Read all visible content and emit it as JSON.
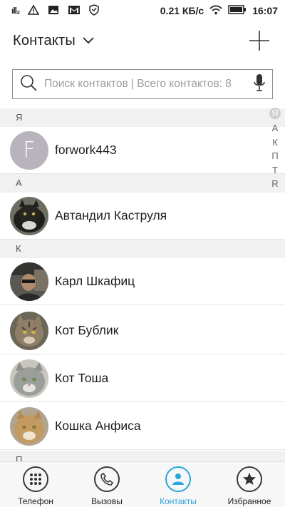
{
  "status_bar": {
    "signal": "ıll₂",
    "speed": "0.21 КБ/с",
    "time": "16:07"
  },
  "header": {
    "title": "Контакты"
  },
  "search": {
    "placeholder": "Поиск контактов | Всего контактов: 8"
  },
  "sections": [
    {
      "letter": "Я"
    },
    {
      "letter": "А"
    },
    {
      "letter": "К"
    },
    {
      "letter": "П"
    }
  ],
  "contacts": [
    {
      "name": "forwork443",
      "avatar_letter": "F",
      "avatar_type": "letter"
    },
    {
      "name": "Автандил Каструля",
      "avatar_type": "photo-cat-black",
      "avatar_color": "#3b3b36"
    },
    {
      "name": "Карл Шкафиц",
      "avatar_type": "photo-person",
      "avatar_color": "#4b4a44"
    },
    {
      "name": "Кот Бублик",
      "avatar_type": "photo-cat-tabby",
      "avatar_color": "#8b7a62"
    },
    {
      "name": "Кот Тоша",
      "avatar_type": "photo-cat-grey",
      "avatar_color": "#a7a9a5"
    },
    {
      "name": "Кошка Анфиса",
      "avatar_type": "photo-cat-ginger",
      "avatar_color": "#b98b55"
    }
  ],
  "index_bar": [
    "Я",
    "А",
    "К",
    "П",
    "Т",
    "R"
  ],
  "bottom_nav": [
    {
      "label": "Телефон",
      "icon": "dialpad-icon",
      "active": false
    },
    {
      "label": "Вызовы",
      "icon": "phone-icon",
      "active": false
    },
    {
      "label": "Контакты",
      "icon": "person-icon",
      "active": true
    },
    {
      "label": "Избранное",
      "icon": "star-icon",
      "active": false
    }
  ],
  "colors": {
    "accent": "#2aa6d9",
    "section_bg": "#f1f1f1",
    "letter_avatar_bg": "#b9b3bd"
  }
}
